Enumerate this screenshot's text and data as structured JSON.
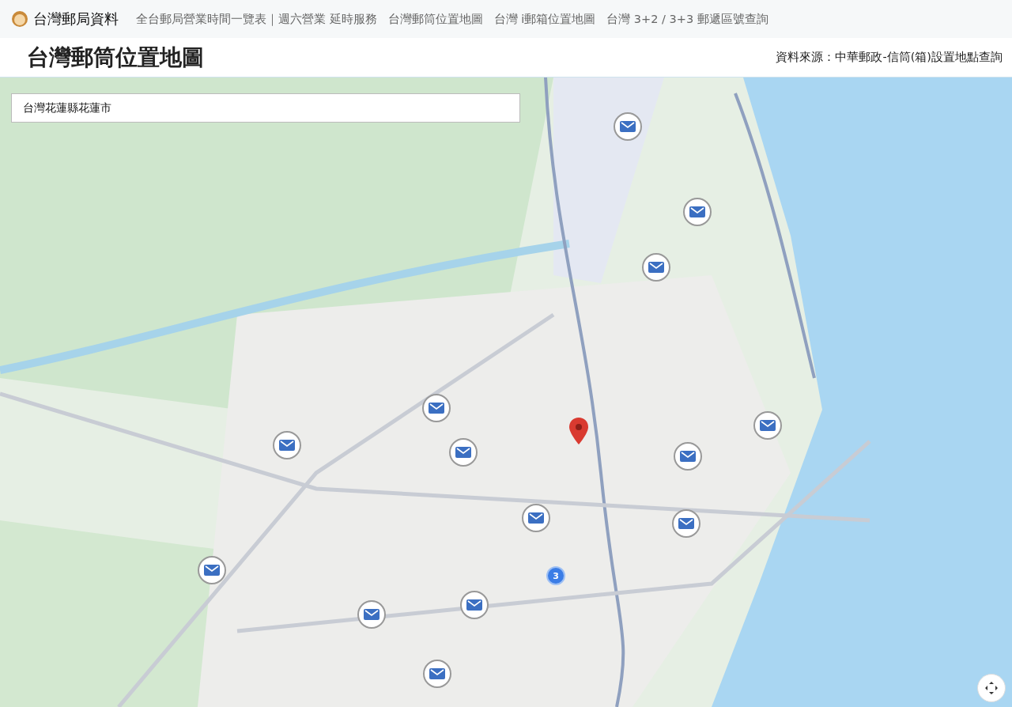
{
  "site": {
    "name": "台灣郵局資料"
  },
  "nav": [
    {
      "label": "全台郵局營業時間一覽表｜週六營業 延時服務"
    },
    {
      "label": "台灣郵筒位置地圖"
    },
    {
      "label": "台灣 i郵箱位置地圖"
    },
    {
      "label": "台灣 3+2 / 3+3 郵遞區號查詢"
    }
  ],
  "page": {
    "title": "台灣郵筒位置地圖",
    "source": "資料來源：中華郵政-信筒(箱)設置地點查詢"
  },
  "map": {
    "search": {
      "value": "台灣花蓮縣花蓮市"
    },
    "markers": [
      {
        "kind": "mailbox"
      },
      {
        "kind": "mailbox"
      },
      {
        "kind": "mailbox"
      },
      {
        "kind": "mailbox"
      },
      {
        "kind": "mailbox"
      },
      {
        "kind": "mailbox"
      },
      {
        "kind": "mailbox"
      },
      {
        "kind": "mailbox"
      },
      {
        "kind": "mailbox"
      },
      {
        "kind": "mailbox"
      },
      {
        "kind": "mailbox"
      },
      {
        "kind": "mailbox"
      },
      {
        "kind": "mailbox"
      },
      {
        "kind": "mailbox"
      },
      {
        "kind": "cluster",
        "count": "3"
      },
      {
        "kind": "pin"
      }
    ]
  }
}
